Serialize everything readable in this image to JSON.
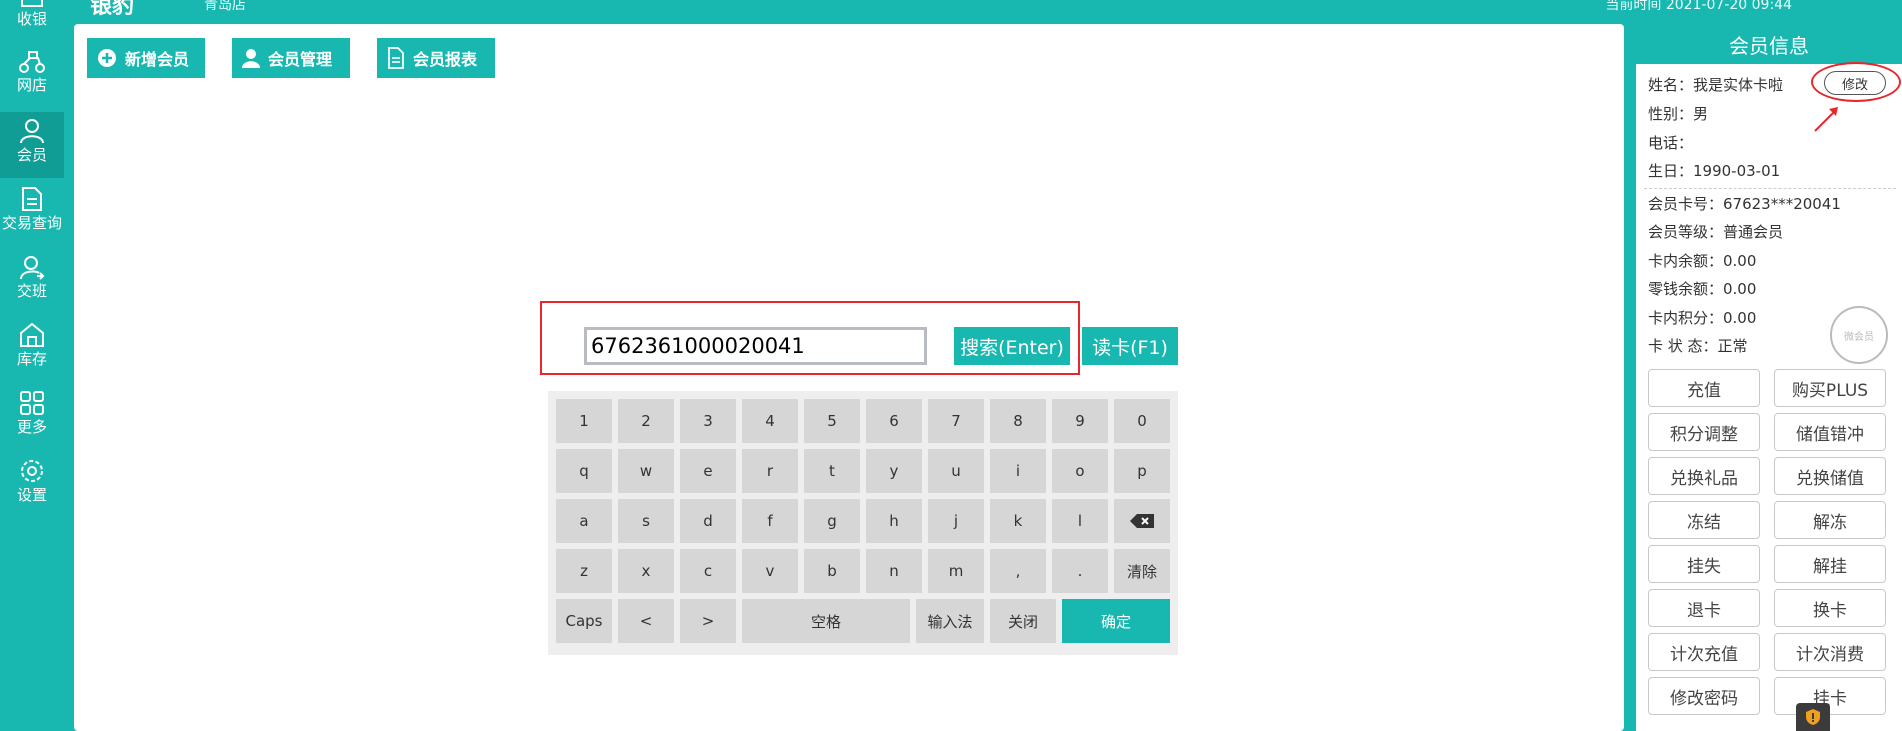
{
  "app": {
    "logo": "银豹",
    "store": "青岛店",
    "top_right": "当前时间 2021-07-20 09:44"
  },
  "sidebar": {
    "items": [
      {
        "label": "收银",
        "icon": "cash-register-icon"
      },
      {
        "label": "网店",
        "icon": "scooter-icon"
      },
      {
        "label": "会员",
        "icon": "user-icon",
        "active": true
      },
      {
        "label": "交易查询",
        "icon": "document-icon"
      },
      {
        "label": "交班",
        "icon": "handover-icon"
      },
      {
        "label": "库存",
        "icon": "warehouse-icon"
      },
      {
        "label": "更多",
        "icon": "grid-icon"
      },
      {
        "label": "设置",
        "icon": "gear-icon"
      }
    ]
  },
  "toolbar": {
    "add_member": "新增会员",
    "member_manage": "会员管理",
    "member_report": "会员报表"
  },
  "search": {
    "value": "6762361000020041",
    "search_button": "搜索(Enter)",
    "read_card_button": "读卡(F1)"
  },
  "keyboard": {
    "row1": [
      "1",
      "2",
      "3",
      "4",
      "5",
      "6",
      "7",
      "8",
      "9",
      "0"
    ],
    "row2": [
      "q",
      "w",
      "e",
      "r",
      "t",
      "y",
      "u",
      "i",
      "o",
      "p"
    ],
    "row3": [
      "a",
      "s",
      "d",
      "f",
      "g",
      "h",
      "j",
      "k",
      "l"
    ],
    "row4": [
      "z",
      "x",
      "c",
      "v",
      "b",
      "n",
      "m",
      ",",
      "."
    ],
    "clear": "清除",
    "caps": "Caps",
    "lt": "<",
    "gt": ">",
    "space": "空格",
    "ime": "输入法",
    "close": "关闭",
    "confirm": "确定"
  },
  "member": {
    "title": "会员信息",
    "edit": "修改",
    "name": "姓名：我是实体卡啦",
    "gender": "性别：男",
    "phone": "电话：",
    "birthday": "生日：1990-03-01",
    "card_no": "会员卡号：67623***20041",
    "level": "会员等级：普通会员",
    "balance": "卡内余额：0.00",
    "change_balance": "零钱余额：0.00",
    "points": "卡内积分：0.00",
    "status": "卡 状 态：正常",
    "stamp": "微会员",
    "actions": [
      "充值",
      "购买PLUS",
      "积分调整",
      "储值错冲",
      "兑换礼品",
      "兑换储值",
      "冻结",
      "解冻",
      "挂失",
      "解挂",
      "退卡",
      "换卡",
      "计次充值",
      "计次消费",
      "修改密码",
      "挂卡"
    ]
  },
  "colors": {
    "accent": "#18b8b0",
    "highlight_red": "#e8262b"
  }
}
